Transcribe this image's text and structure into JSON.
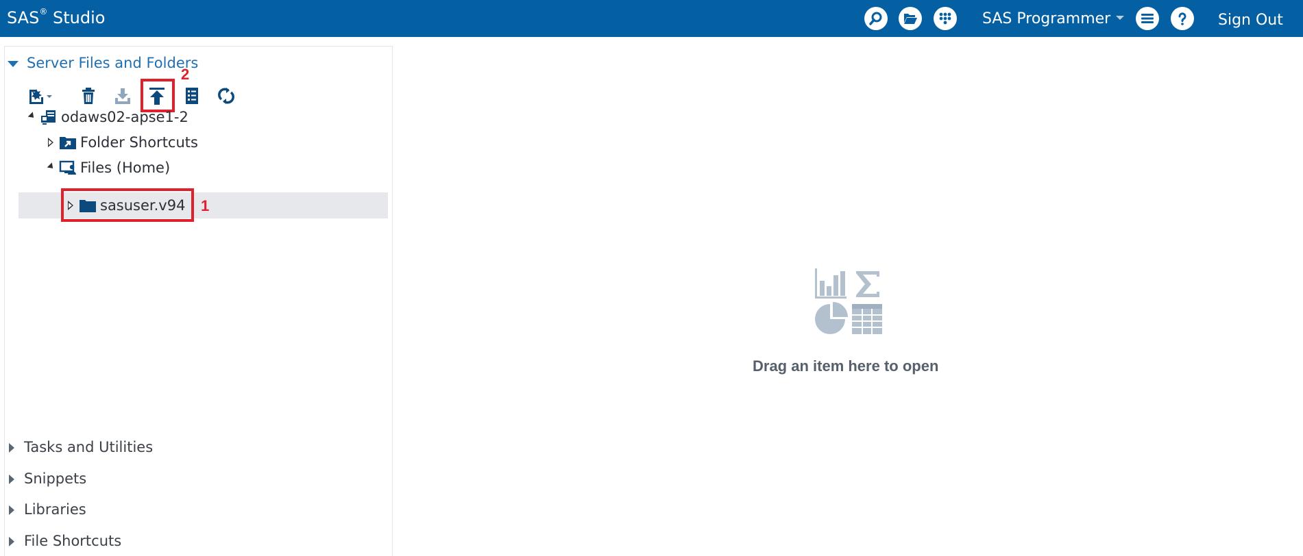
{
  "app": {
    "title": "SAS",
    "title_mark": "®",
    "title_suffix": "Studio",
    "brand_color": "#0560a3",
    "perspective": "SAS Programmer",
    "sign_out": "Sign Out",
    "icons": [
      "search-icon",
      "open-folder-icon",
      "apps-grid-icon",
      "menu-list-icon",
      "help-icon"
    ]
  },
  "sidebar": {
    "server_files": {
      "title": "Server Files and Folders",
      "toolbar": [
        "new-item-icon",
        "delete-icon",
        "download-icon",
        "upload-icon",
        "properties-icon",
        "refresh-icon"
      ],
      "tree": {
        "server": "odaws02-apse1-2",
        "folder_shortcuts": "Folder Shortcuts",
        "files_home": "Files (Home)",
        "sasuser": "sasuser.v94"
      }
    },
    "sections": [
      "Tasks and Utilities",
      "Snippets",
      "Libraries",
      "File Shortcuts"
    ]
  },
  "annotations": {
    "first": "1",
    "second": "2",
    "color": "#e0202a"
  },
  "workspace": {
    "drop_text": "Drag an item here to open"
  }
}
